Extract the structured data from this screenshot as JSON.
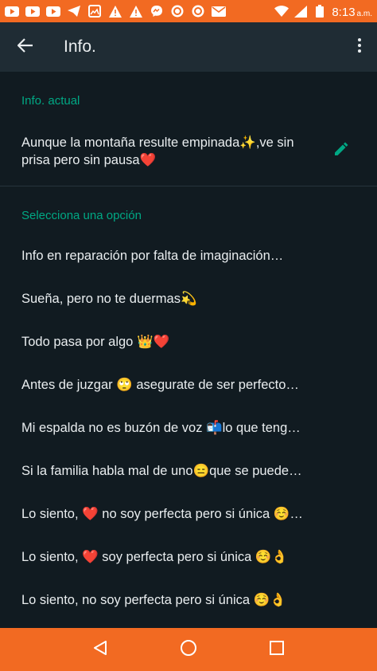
{
  "status_bar": {
    "time": "8:13",
    "ampm": "a.m.",
    "icons": [
      "youtube-icon",
      "youtube-icon",
      "youtube-icon",
      "telegram-icon",
      "gallery-icon",
      "warning-icon",
      "warning-icon",
      "messenger-icon",
      "chrome-icon",
      "chrome-icon",
      "mail-icon",
      "wifi-icon",
      "signal-icon",
      "battery-icon"
    ],
    "background": "#f26a22"
  },
  "toolbar": {
    "title": "Info.",
    "background": "#1f2c34"
  },
  "current": {
    "section_label": "Info. actual",
    "text": "Aunque la montaña resulte empinada✨,ve sin prisa pero sin pausa❤️"
  },
  "options": {
    "section_label": "Selecciona una opción",
    "items": [
      "Info en reparación por falta de imaginación…",
      "Sueña, pero no te duermas💫",
      "Todo pasa por algo 👑❤️",
      "Antes de juzgar 🙄 asegurate de ser perfecto…",
      "Mi espalda no es buzón de voz 📬lo que teng…",
      "Si la familia habla mal de uno😑que se puede…",
      "Lo siento, ❤️ no soy perfecta pero si única ☺️…",
      "Lo siento, ❤️ soy perfecta pero si única ☺️👌",
      "Lo siento, no soy perfecta pero si única ☺️👌"
    ]
  },
  "colors": {
    "accent": "#00a884",
    "background": "#111b21",
    "text": "#e9edef",
    "navbar": "#f26a22"
  }
}
